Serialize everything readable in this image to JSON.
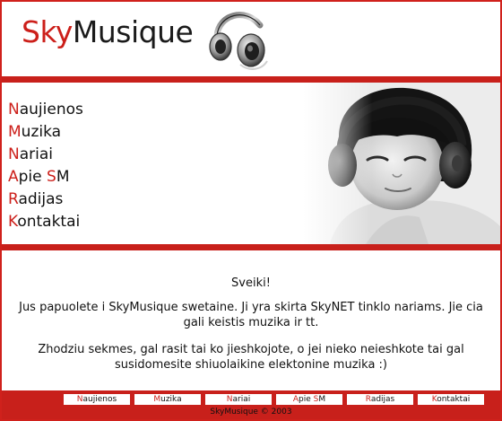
{
  "colors": {
    "accent": "#c8201b",
    "text": "#111111",
    "background": "#ffffff"
  },
  "header": {
    "logo_sky": "Sky",
    "logo_musique": "Musique",
    "logo_icon": "headphones-icon"
  },
  "nav": {
    "items": [
      {
        "first": "N",
        "rest": "aujienos"
      },
      {
        "first": "M",
        "rest": "uzika"
      },
      {
        "first": "N",
        "rest": "ariai"
      },
      {
        "first": "A",
        "rest": "pie ",
        "second": "S",
        "rest2": "M"
      },
      {
        "first": "R",
        "rest": "adijas"
      },
      {
        "first": "K",
        "rest": "ontaktai"
      }
    ]
  },
  "banner": {
    "photo": "child-with-headphones-photo"
  },
  "content": {
    "greeting": "Sveiki!",
    "paragraph1": "Jus papuolete i SkyMusique swetaine. Ji yra skirta SkyNET tinklo nariams. Jie cia gali keistis muzika ir tt.",
    "paragraph2": "Zhodziu sekmes, gal rasit tai ko jieshkojote, o jei nieko neieshkote tai gal susidomesite shiuolaikine elektonine muzika :)"
  },
  "footer": {
    "links": [
      {
        "first": "N",
        "rest": "aujienos"
      },
      {
        "first": "M",
        "rest": "uzika"
      },
      {
        "first": "N",
        "rest": "ariai"
      },
      {
        "first": "A",
        "rest": "pie ",
        "second": "S",
        "rest2": "M"
      },
      {
        "first": "R",
        "rest": "adijas"
      },
      {
        "first": "K",
        "rest": "ontaktai"
      }
    ],
    "copyright": "SkyMusique © 2003"
  }
}
